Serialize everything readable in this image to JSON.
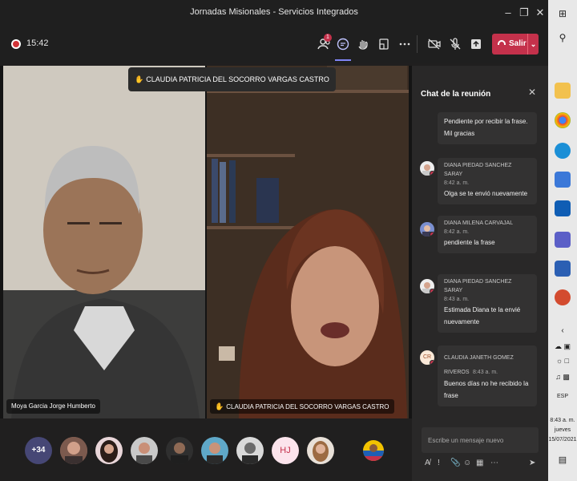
{
  "window": {
    "title": "Jornadas Misionales - Servicios Integrados"
  },
  "toolbar": {
    "timer": "15:42",
    "participants_badge": "1",
    "leave_label": "Salir"
  },
  "stage": {
    "top_label": "CLAUDIA PATRICIA DEL SOCORRO VARGAS CASTRO",
    "tiles": [
      {
        "name": "Moya Garcia Jorge Humberto"
      },
      {
        "name": "CLAUDIA PATRICIA DEL SOCORRO VARGAS CASTRO"
      }
    ]
  },
  "participants_row": {
    "more_count": "+34",
    "initials": "HJ"
  },
  "chat": {
    "title": "Chat de la reunión",
    "messages": [
      {
        "sender": "",
        "time": "",
        "text": "Pendiente por recibir la frase. Mil gracias"
      },
      {
        "sender": "DIANA PIEDAD SANCHEZ SARAY",
        "time": "8:42 a. m.",
        "text": "Olga se te envió nuevamente"
      },
      {
        "sender": "DIANA MILENA CARVAJAL",
        "time": "8:42 a. m.",
        "text": "pendiente la frase"
      },
      {
        "sender": "DIANA PIEDAD SANCHEZ SARAY",
        "time": "8:43 a. m.",
        "text": "Estimada Diana te la envié nuevamente"
      },
      {
        "sender": "CLAUDIA JANETH GOMEZ RIVEROS",
        "time": "8:43 a. m.",
        "text": "Buenos días no he recibido la frase",
        "initials": "CR"
      }
    ],
    "compose_placeholder": "Escribe un mensaje nuevo"
  },
  "taskbar": {
    "language": "ESP",
    "clock_time": "8:43 a. m.",
    "clock_day": "jueves",
    "clock_date": "15/07/2021"
  },
  "colors": {
    "leave": "#c4314b",
    "accent": "#7f85f5",
    "status_busy": "#c4314b"
  }
}
